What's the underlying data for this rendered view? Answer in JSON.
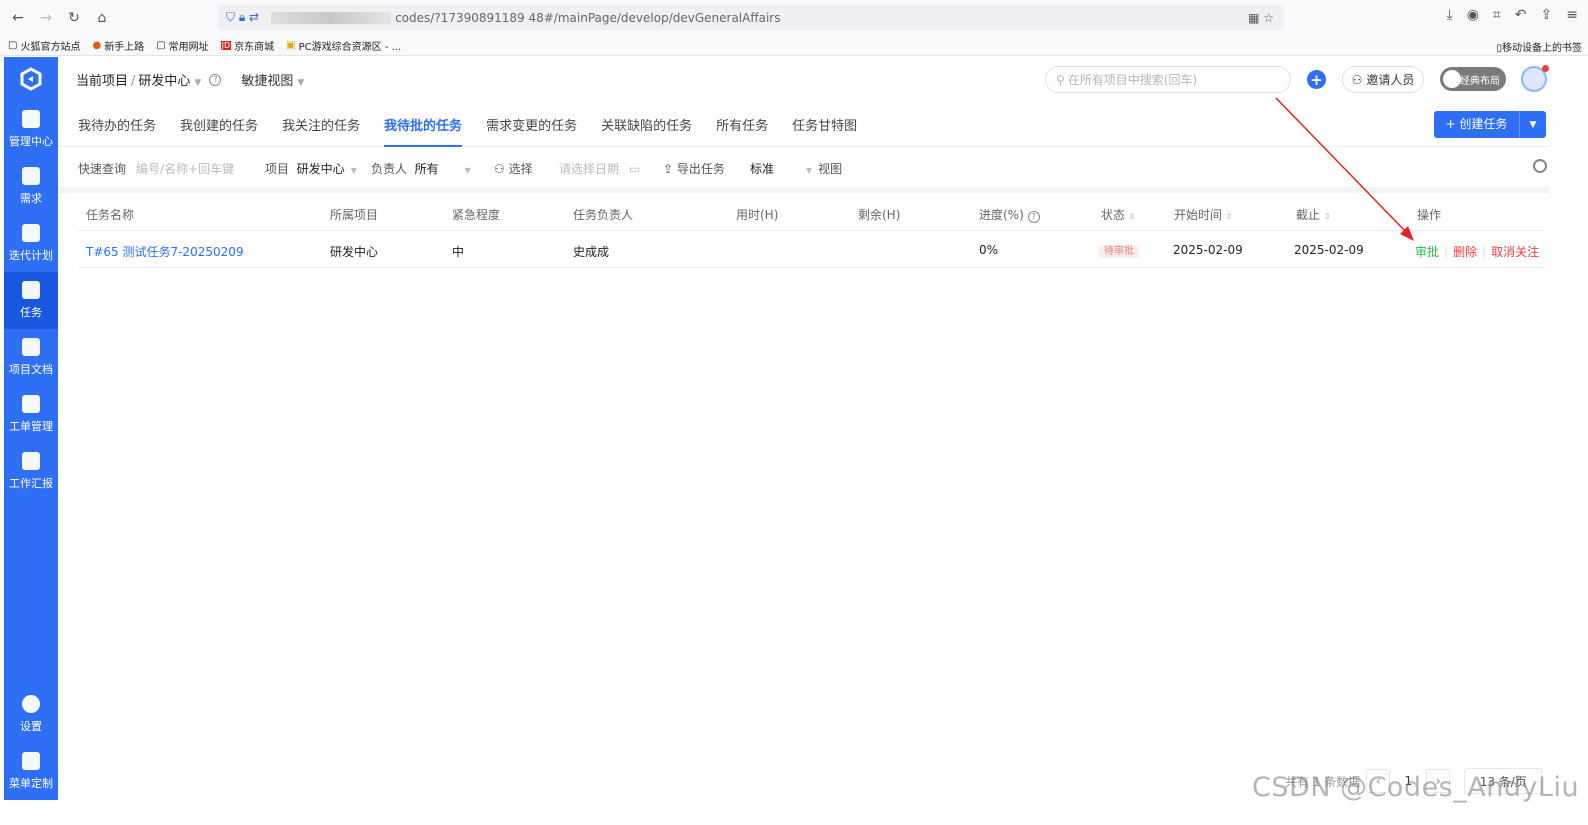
{
  "browser": {
    "url": "codes/?17390891189 48#/mainPage/develop/devGeneralAffairs",
    "bookmarks": [
      "火狐官方站点",
      "新手上路",
      "常用网址",
      "京东商城",
      "PC游戏综合资源区 - ..."
    ],
    "mobile_bookmarks": "移动设备上的书签"
  },
  "sidebar": {
    "items": [
      {
        "label": "管理中心",
        "icon": "monitor-icon"
      },
      {
        "label": "需求",
        "icon": "document-icon"
      },
      {
        "label": "迭代计划",
        "icon": "layers-icon"
      },
      {
        "label": "任务",
        "icon": "calendar-icon"
      },
      {
        "label": "项目文档",
        "icon": "files-icon"
      },
      {
        "label": "工单管理",
        "icon": "ticket-icon"
      },
      {
        "label": "工作汇报",
        "icon": "report-icon"
      }
    ],
    "bottom": [
      {
        "label": "设置",
        "icon": "settings-icon"
      },
      {
        "label": "菜单定制",
        "icon": "grid-icon"
      }
    ]
  },
  "header": {
    "current_project": "当前项目",
    "project_name": "研发中心",
    "quick_view": "敏捷视图",
    "search_placeholder": "在所有项目中搜索(回车)",
    "invite": "邀请人员",
    "layout_toggle": "经典布局"
  },
  "tabs": [
    "我待办的任务",
    "我创建的任务",
    "我关注的任务",
    "我待批的任务",
    "需求变更的任务",
    "关联缺陷的任务",
    "所有任务",
    "任务甘特图"
  ],
  "create_button": "+ 创建任务",
  "filters": {
    "quick_query": "快速查询",
    "quick_placeholder": "编号/名称+回车键",
    "project_label": "项目",
    "project_value": "研发中心",
    "owner_label": "负责人",
    "owner_value": "所有",
    "select": "选择",
    "date_placeholder": "请选择日期",
    "export": "导出任务",
    "standard": "标准",
    "view": "视图"
  },
  "table": {
    "columns": [
      "任务名称",
      "所属项目",
      "紧急程度",
      "任务负责人",
      "用时(H)",
      "剩余(H)",
      "进度(%)",
      "状态",
      "开始时间",
      "截止",
      "操作"
    ],
    "rows": [
      {
        "name": "T#65 测试任务7-20250209",
        "project": "研发中心",
        "urgency": "中",
        "owner": "史成成",
        "used": "",
        "remaining": "",
        "progress": "0%",
        "status": "待审批",
        "start": "2025-02-09",
        "due": "2025-02-09",
        "actions": [
          "审批",
          "删除",
          "取消关注"
        ]
      }
    ]
  },
  "pager": {
    "total": "共有 1 条数据",
    "page": "1",
    "page_size": "13 条/页"
  },
  "watermark": "CSDN @Codes_AndyLiu"
}
